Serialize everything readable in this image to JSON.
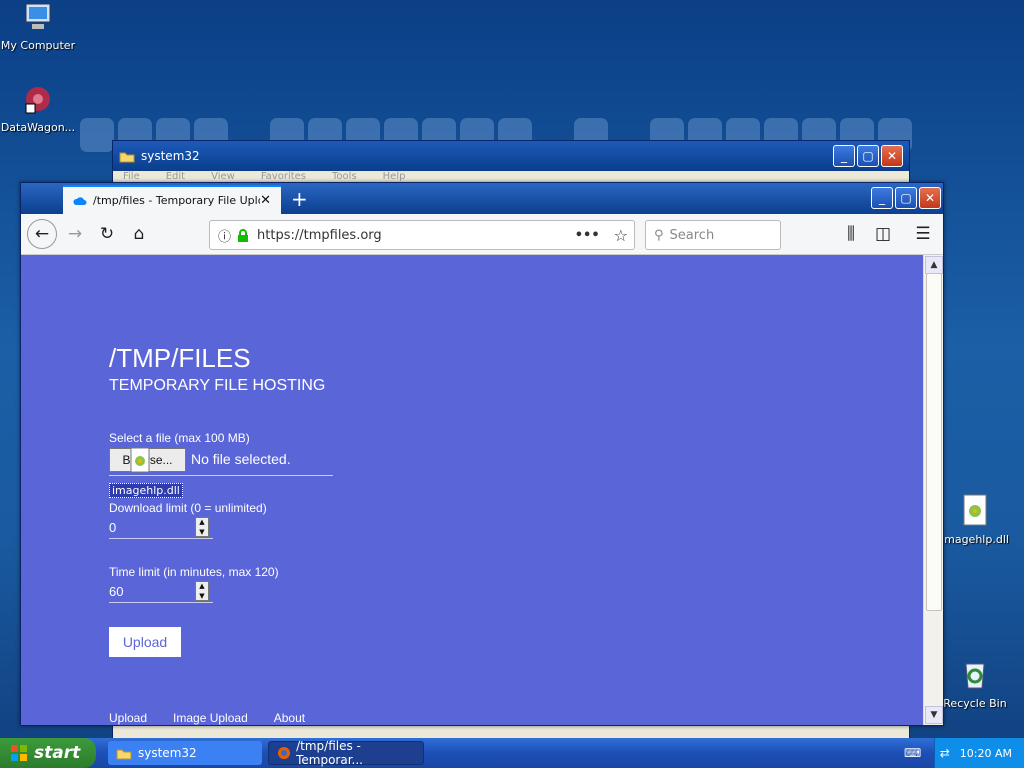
{
  "desktop": {
    "icons": [
      {
        "label": "My Computer"
      },
      {
        "label": "DataWagon..."
      },
      {
        "label": "imagehlp.dll"
      },
      {
        "label": "Recycle Bin"
      }
    ]
  },
  "back_window": {
    "title": "system32",
    "menu": [
      "File",
      "Edit",
      "View",
      "Favorites",
      "Tools",
      "Help"
    ]
  },
  "browser": {
    "tab_title": "/tmp/files - Temporary File Upload",
    "url": "https://tmpfiles.org",
    "search_placeholder": "Search"
  },
  "page": {
    "title": "/TMP/FILES",
    "subtitle": "TEMPORARY FILE HOSTING",
    "file_label": "Select a file (max 100 MB)",
    "browse_label": "Browse...",
    "no_file": "No file selected.",
    "drag_file": "imagehlp.dll",
    "download_label": "Download limit (0 = unlimited)",
    "download_value": "0",
    "time_label": "Time limit (in minutes, max 120)",
    "time_value": "60",
    "upload_button": "Upload",
    "footer": [
      "Upload",
      "Image Upload",
      "About"
    ]
  },
  "taskbar": {
    "start": "start",
    "tasks": [
      {
        "label": "system32"
      },
      {
        "label": "/tmp/files - Temporar..."
      }
    ],
    "clock": "10:20 AM"
  },
  "colors": {
    "page_bg": "#5a65d8",
    "titlebar": "#0c3f8f",
    "taskbar": "#1d4fb5",
    "start_green": "#2c7c2c"
  }
}
